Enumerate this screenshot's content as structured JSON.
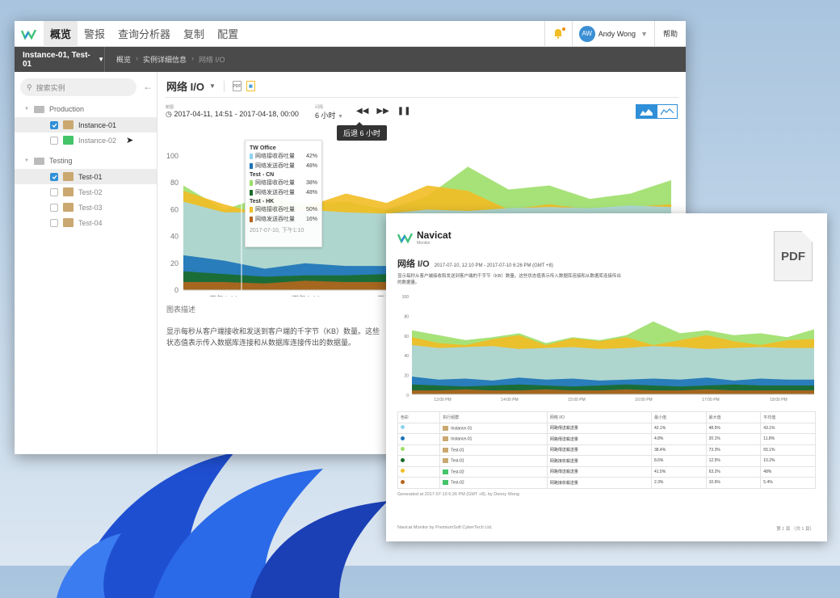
{
  "nav": {
    "items": [
      "概览",
      "警报",
      "查询分析器",
      "复制",
      "配置"
    ],
    "user_initials": "AW",
    "user_name": "Andy Wong",
    "help": "帮助"
  },
  "subbar": {
    "instance": "Instance-01, Test-01",
    "crumbs": [
      "概览",
      "实例详细信息",
      "网络 I/O"
    ]
  },
  "sidebar": {
    "search_placeholder": "搜索实例",
    "groups": [
      {
        "name": "Production",
        "items": [
          {
            "label": "Instance-01",
            "checked": true,
            "icon": "tan"
          },
          {
            "label": "Instance-02",
            "checked": false,
            "icon": "green"
          }
        ]
      },
      {
        "name": "Testing",
        "items": [
          {
            "label": "Test-01",
            "checked": true,
            "icon": "tan"
          },
          {
            "label": "Test-02",
            "checked": false,
            "icon": "green"
          },
          {
            "label": "Test-03",
            "checked": false,
            "icon": "tan"
          },
          {
            "label": "Test-04",
            "checked": false,
            "icon": "green"
          }
        ]
      }
    ]
  },
  "main": {
    "title": "网络 I/O",
    "range_label": "範圍",
    "range": "2017-04-11, 14:51 - 2017-04-18, 00:00",
    "interval_label": "间隔",
    "interval": "6 小时",
    "tooltip": "后退 6 小时",
    "desc_heading": "图表描述",
    "description": "显示每秒从客户端接收和发送到客户端的千字节（KB）数量。这些状态值表示传入数据库连接和从数据库连接传出的数据量。"
  },
  "hover": {
    "groups": [
      {
        "name": "TW Office",
        "rows": [
          [
            "网络接收吞吐量",
            "42%",
            "#8fd3f0"
          ],
          [
            "网络发送吞吐量",
            "48%",
            "#1b73b8"
          ]
        ]
      },
      {
        "name": "Test - CN",
        "rows": [
          [
            "网络接收吞吐量",
            "38%",
            "#9ddf6a"
          ],
          [
            "网络发送吞吐量",
            "48%",
            "#1a6b2a"
          ]
        ]
      },
      {
        "name": "Test - HK",
        "rows": [
          [
            "网络接收吞吐量",
            "50%",
            "#f2bd25"
          ],
          [
            "网络发送吞吐量",
            "16%",
            "#b5651d"
          ]
        ]
      }
    ],
    "time": "2017-07-10, 下午1:10"
  },
  "chart_data": [
    {
      "type": "area",
      "ylim": [
        0,
        100
      ],
      "yticks": [
        0,
        20,
        40,
        60,
        80,
        100
      ],
      "xticks": [
        "下午1:00",
        "下午2:00",
        "下午3:00"
      ],
      "series": [
        {
          "color": "#9ddf6a",
          "values": [
            78,
            60,
            70,
            64,
            66,
            60,
            70,
            92,
            75,
            78,
            68,
            72,
            82
          ]
        },
        {
          "color": "#f2bd25",
          "values": [
            74,
            64,
            56,
            62,
            72,
            65,
            78,
            74,
            60,
            64,
            60,
            62,
            64
          ]
        },
        {
          "color": "#a8d8e0",
          "values": [
            66,
            58,
            58,
            60,
            58,
            57,
            60,
            59,
            61,
            62,
            61,
            63,
            62
          ]
        },
        {
          "color": "#1b73b8",
          "values": [
            26,
            22,
            16,
            20,
            18,
            18,
            20,
            19,
            18,
            20,
            18,
            19,
            18
          ]
        },
        {
          "color": "#1a6b2a",
          "values": [
            14,
            12,
            10,
            11,
            11,
            12,
            11,
            12,
            11,
            11,
            12,
            11,
            12
          ]
        },
        {
          "color": "#b5651d",
          "values": [
            6,
            6,
            5,
            7,
            6,
            6,
            5,
            6,
            6,
            5,
            6,
            6,
            5
          ]
        }
      ]
    },
    {
      "type": "area",
      "ylim": [
        0,
        100
      ],
      "yticks": [
        0,
        20,
        40,
        60,
        80,
        100
      ],
      "xticks": [
        "13:00 PM",
        "14:00 PM",
        "15:00 PM",
        "16:00 PM",
        "17:00 PM",
        "18:00 PM"
      ],
      "series": [
        {
          "color": "#9ddf6a",
          "values": [
            65,
            60,
            55,
            58,
            62,
            52,
            58,
            55,
            60,
            74,
            62,
            65,
            60,
            62,
            58,
            66
          ]
        },
        {
          "color": "#f2bd25",
          "values": [
            58,
            52,
            50,
            56,
            60,
            50,
            57,
            54,
            58,
            50,
            55,
            60,
            54,
            50,
            55,
            56
          ]
        },
        {
          "color": "#a8d8e0",
          "values": [
            50,
            47,
            48,
            49,
            46,
            47,
            48,
            46,
            47,
            49,
            48,
            46,
            47,
            48,
            47,
            47
          ]
        },
        {
          "color": "#1b73b8",
          "values": [
            18,
            15,
            16,
            14,
            17,
            15,
            16,
            14,
            15,
            16,
            15,
            17,
            14,
            16,
            15,
            15
          ]
        },
        {
          "color": "#1a6b2a",
          "values": [
            10,
            9,
            8,
            9,
            10,
            9,
            8,
            9,
            10,
            9,
            8,
            9,
            10,
            9,
            9,
            9
          ]
        },
        {
          "color": "#b5651d",
          "values": [
            4,
            4,
            5,
            4,
            4,
            5,
            4,
            4,
            5,
            4,
            4,
            5,
            4,
            4,
            4,
            4
          ]
        }
      ]
    }
  ],
  "pdf": {
    "brand": "Navicat",
    "brand_sub": "Monitor",
    "icon_text": "PDF",
    "title": "网络 I/O",
    "range": "2017-07-10, 12:10 PM - 2017-07-10 6:26 PM (GMT +8)",
    "desc": "显示每秒从客户端接收和发送到客户端的千字节（KB）数量。这些状态值表示传入数据库连接和从数据库连接传出的数据量。",
    "table_headers": [
      "色彩",
      "执行组群",
      "网络 I/O",
      "最小值",
      "最大值",
      "平均值"
    ],
    "rows": [
      [
        "#8fd3f0",
        "Instance-01",
        "网路傳送載送量",
        "42.1%",
        "48.5%",
        "43.1%"
      ],
      [
        "#1b73b8",
        "Instance-01",
        "网路傳送載送量",
        "4.8%",
        "20.1%",
        "11.8%"
      ],
      [
        "#9ddf6a",
        "Test-01",
        "网路傳送載送量",
        "38.4%",
        "73.3%",
        "55.1%"
      ],
      [
        "#1a6b2a",
        "Test-01",
        "网路接收載送量",
        "8.6%",
        "12.5%",
        "10.2%"
      ],
      [
        "#f2bd25",
        "Test-02",
        "网路傳送載送量",
        "41.5%",
        "63.2%",
        "48%"
      ],
      [
        "#b5651d",
        "Test-02",
        "网路接收載送量",
        "2.3%",
        "10.6%",
        "5.4%"
      ]
    ],
    "generated": "Generated at 2017-07-10 6:26 PM (GMT +8), by Denny Wong",
    "footer": "Navicat Monitor by PremiumSoft CyberTech Ltd.",
    "page": "第 1 頁 （共 1 頁）"
  }
}
